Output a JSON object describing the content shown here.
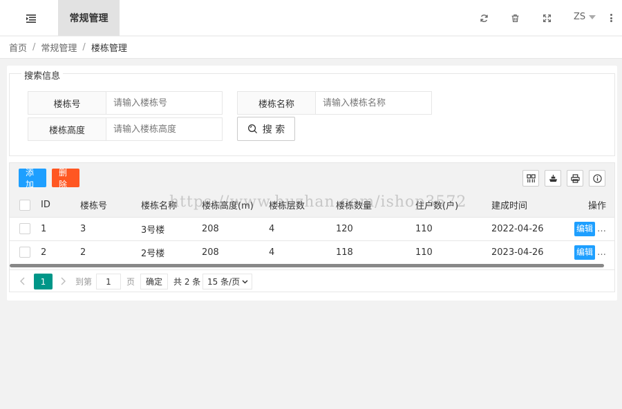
{
  "header": {
    "nav_active": "常规管理",
    "user": "ZS"
  },
  "breadcrumb": [
    "首页",
    "常规管理",
    "楼栋管理"
  ],
  "search": {
    "legend": "搜索信息",
    "fields": [
      {
        "label": "楼栋号",
        "placeholder": "请输入楼栋号",
        "value": ""
      },
      {
        "label": "楼栋名称",
        "placeholder": "请输入楼栋名称",
        "value": ""
      },
      {
        "label": "楼栋高度",
        "placeholder": "请输入楼栋高度",
        "value": ""
      }
    ],
    "button_label": "搜 索"
  },
  "toolbar": {
    "add_label": "添加",
    "delete_label": "删除"
  },
  "table": {
    "columns": [
      "ID",
      "楼栋号",
      "楼栋名称",
      "楼栋高度(m)",
      "楼栋层数",
      "楼栋数量",
      "住户数(户)",
      "建成时间",
      "操作"
    ],
    "rows": [
      {
        "id": "1",
        "code": "3",
        "name": "3号楼",
        "height": "208",
        "floors": "4",
        "count": "120",
        "households": "110",
        "built": "2022-04-26",
        "action": "编辑",
        "more": "…"
      },
      {
        "id": "2",
        "code": "2",
        "name": "2号楼",
        "height": "208",
        "floors": "4",
        "count": "118",
        "households": "110",
        "built": "2023-04-26",
        "action": "编辑",
        "more": "…"
      }
    ]
  },
  "pager": {
    "current": "1",
    "goto_label": "到第",
    "goto_value": "1",
    "page_label": "页",
    "confirm_label": "确定",
    "total_label": "共 2 条",
    "page_size": "15 条/页"
  },
  "watermark": "https://www.huzhan.com/ishop3572",
  "colors": {
    "primary_blue": "#1e9fff",
    "danger_orange": "#ff5722",
    "pager_green": "#009688"
  }
}
